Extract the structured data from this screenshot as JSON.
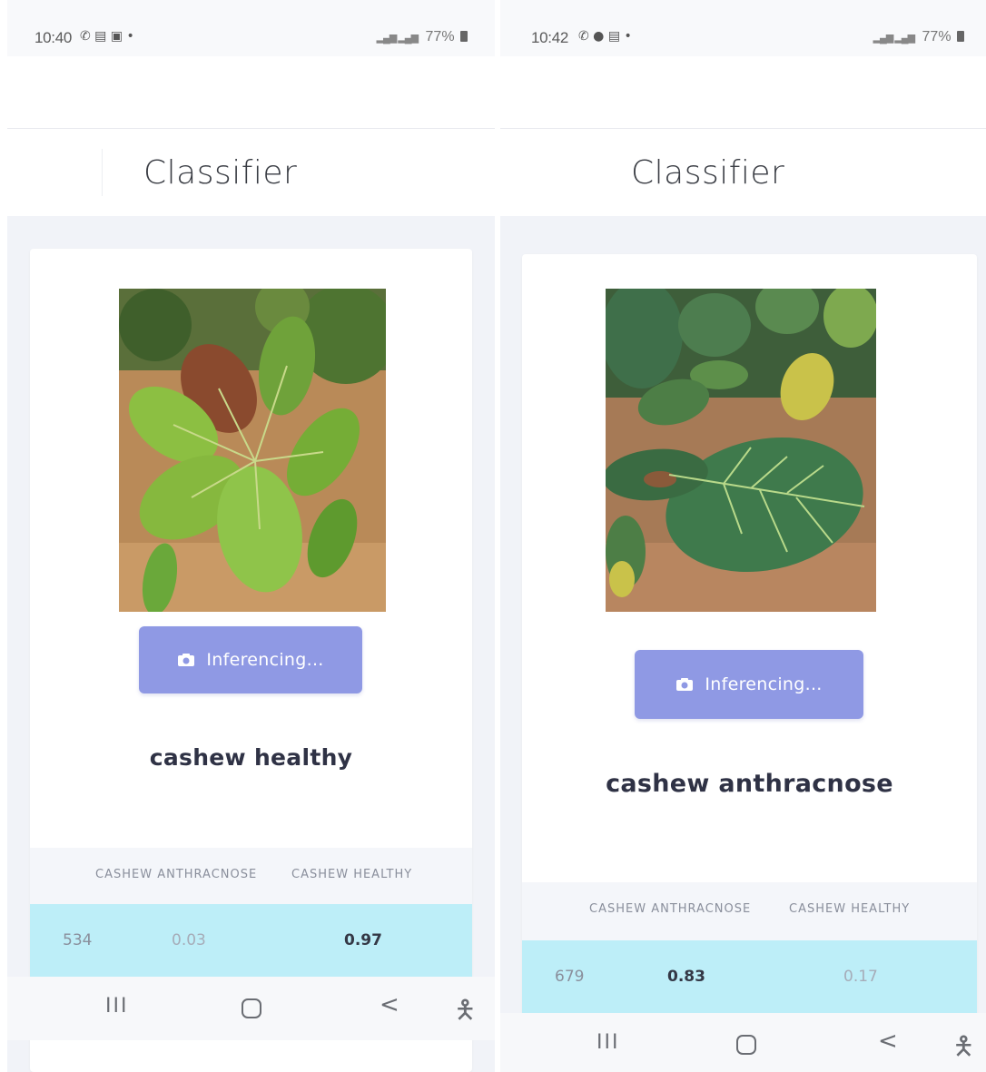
{
  "screens": [
    {
      "status": {
        "time": "10:40",
        "battery": "77%"
      },
      "header": {
        "title": "Classifier"
      },
      "photo": {
        "subject": "cashew leaves, young reddish leaf center"
      },
      "button": {
        "label": "Inferencing...",
        "icon": "camera-icon"
      },
      "result": {
        "label": "cashew healthy"
      },
      "table": {
        "columns": [
          "CASHEW ANTHRACNOSE",
          "CASHEW HEALTHY"
        ],
        "rows": [
          {
            "id": "534",
            "anthracnose": "0.03",
            "healthy": "0.97"
          }
        ]
      },
      "nav": {
        "recent": "III",
        "back": "<",
        "accessibility": "accessibility-icon"
      }
    },
    {
      "status": {
        "time": "10:42",
        "battery": "77%"
      },
      "header": {
        "title": "Classifier"
      },
      "photo": {
        "subject": "large green cashew leaf with lesions"
      },
      "button": {
        "label": "Inferencing...",
        "icon": "camera-icon"
      },
      "result": {
        "label": "cashew anthracnose"
      },
      "table": {
        "columns": [
          "CASHEW ANTHRACNOSE",
          "CASHEW HEALTHY"
        ],
        "rows": [
          {
            "id": "679",
            "anthracnose": "0.83",
            "healthy": "0.17"
          }
        ]
      },
      "nav": {
        "recent": "III",
        "back": "<",
        "accessibility": "accessibility-icon"
      }
    }
  ]
}
